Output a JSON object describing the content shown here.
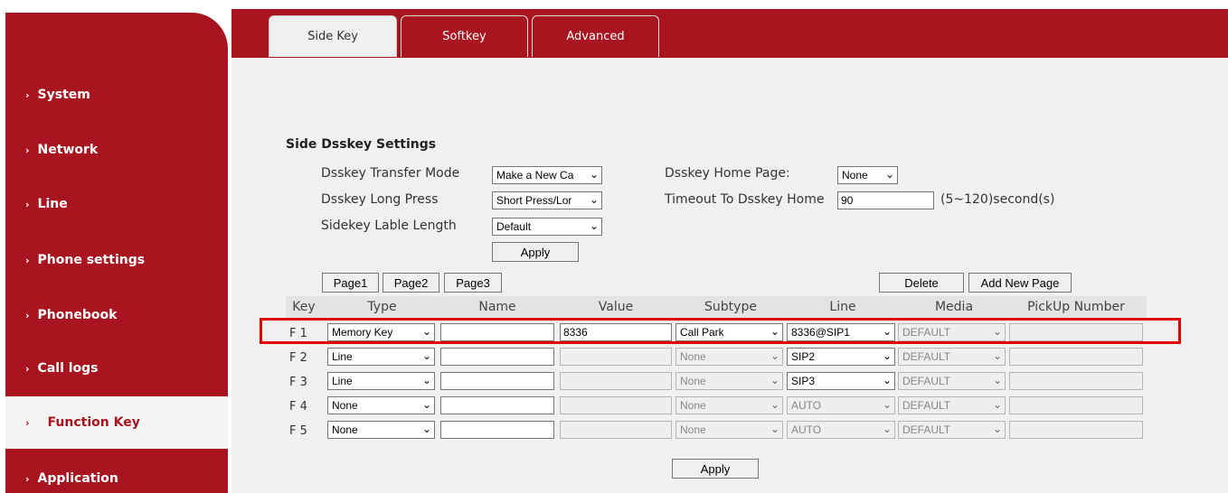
{
  "sidebar": {
    "items": [
      {
        "label": "System"
      },
      {
        "label": "Network"
      },
      {
        "label": "Line"
      },
      {
        "label": "Phone settings"
      },
      {
        "label": "Phonebook"
      },
      {
        "label": "Call logs"
      },
      {
        "label": "Function Key",
        "active": true
      },
      {
        "label": "Application"
      }
    ]
  },
  "tabs": [
    {
      "label": "Side Key",
      "active": true
    },
    {
      "label": "Softkey"
    },
    {
      "label": "Advanced"
    }
  ],
  "settings": {
    "title": "Side Dsskey Settings",
    "transfer_mode_label": "Dsskey Transfer Mode",
    "transfer_mode_value": "Make a New Ca",
    "long_press_label": "Dsskey Long Press",
    "long_press_value": "Short Press/Lor",
    "lable_length_label": "Sidekey Lable Length",
    "lable_length_value": "Default",
    "home_page_label": "Dsskey Home Page:",
    "home_page_value": "None",
    "timeout_label": "Timeout To Dsskey Home",
    "timeout_value": "90",
    "timeout_unit": "(5~120)second(s)",
    "apply_label": "Apply"
  },
  "pages": {
    "buttons": [
      "Page1",
      "Page2",
      "Page3"
    ],
    "delete_label": "Delete",
    "add_label": "Add New Page"
  },
  "table": {
    "headers": [
      "Key",
      "Type",
      "Name",
      "Value",
      "Subtype",
      "Line",
      "Media",
      "PickUp Number"
    ],
    "rows": [
      {
        "key": "F 1",
        "type": "Memory Key",
        "name": "",
        "value": "8336",
        "subtype": "Call Park",
        "line": "8336@SIP1",
        "media": "DEFAULT",
        "pickup": ""
      },
      {
        "key": "F 2",
        "type": "Line",
        "name": "",
        "value": "",
        "subtype": "None",
        "line": "SIP2",
        "media": "DEFAULT",
        "pickup": ""
      },
      {
        "key": "F 3",
        "type": "Line",
        "name": "",
        "value": "",
        "subtype": "None",
        "line": "SIP3",
        "media": "DEFAULT",
        "pickup": ""
      },
      {
        "key": "F 4",
        "type": "None",
        "name": "",
        "value": "",
        "subtype": "None",
        "line": "AUTO",
        "media": "DEFAULT",
        "pickup": ""
      },
      {
        "key": "F 5",
        "type": "None",
        "name": "",
        "value": "",
        "subtype": "None",
        "line": "AUTO",
        "media": "DEFAULT",
        "pickup": ""
      }
    ]
  },
  "bottom_apply_label": "Apply",
  "colors": {
    "brand": "#a8141f",
    "highlight": "#e00000"
  },
  "icons": {
    "chevron": "chevron-right-icon",
    "dropdown": "chevron-down-icon"
  }
}
